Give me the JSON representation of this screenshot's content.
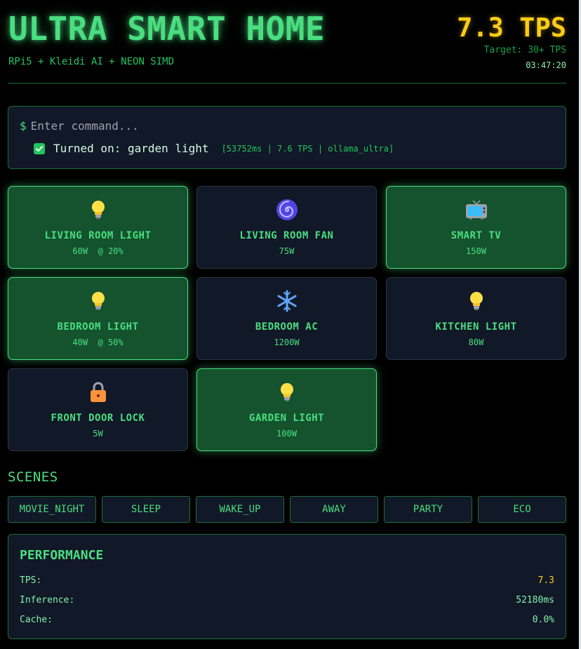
{
  "header": {
    "title": "ULTRA SMART HOME",
    "subtitle": "RPi5 + Kleidi AI + NEON SIMD",
    "tps": "7.3 TPS",
    "target": "Target: 30+ TPS",
    "clock": "03:47:20"
  },
  "command": {
    "prompt": "$",
    "placeholder": "Enter command...",
    "result_text": "Turned on: garden light",
    "result_meta": "[53752ms | 7.6 TPS | ollama_ultra]"
  },
  "devices": [
    {
      "name": "LIVING ROOM LIGHT",
      "power": "60W  @ 20%",
      "icon": "lightbulb-icon",
      "on": true
    },
    {
      "name": "LIVING ROOM FAN",
      "power": "75W",
      "icon": "fan-icon",
      "on": false
    },
    {
      "name": "SMART TV",
      "power": "150W",
      "icon": "tv-icon",
      "on": true
    },
    {
      "name": "BEDROOM LIGHT",
      "power": "40W  @ 50%",
      "icon": "lightbulb-icon",
      "on": true
    },
    {
      "name": "BEDROOM AC",
      "power": "1200W",
      "icon": "snowflake-icon",
      "on": false
    },
    {
      "name": "KITCHEN LIGHT",
      "power": "80W",
      "icon": "lightbulb-icon",
      "on": false
    },
    {
      "name": "FRONT DOOR LOCK",
      "power": "5W",
      "icon": "lock-icon",
      "on": false
    },
    {
      "name": "GARDEN LIGHT",
      "power": "100W",
      "icon": "lightbulb-icon",
      "on": true
    }
  ],
  "scenes": {
    "title": "SCENES",
    "items": [
      "MOVIE_NIGHT",
      "SLEEP",
      "WAKE_UP",
      "AWAY",
      "PARTY",
      "ECO"
    ]
  },
  "performance": {
    "title": "PERFORMANCE",
    "tps_label": "TPS:",
    "tps_value": "7.3",
    "inference_label": "Inference:",
    "inference_value": "52180ms",
    "cache_label": "Cache:",
    "cache_value": "0.0%"
  },
  "colors": {
    "accent": "#4ade80",
    "tps": "#facc15",
    "panel": "#111827",
    "active_panel": "#14532d"
  }
}
